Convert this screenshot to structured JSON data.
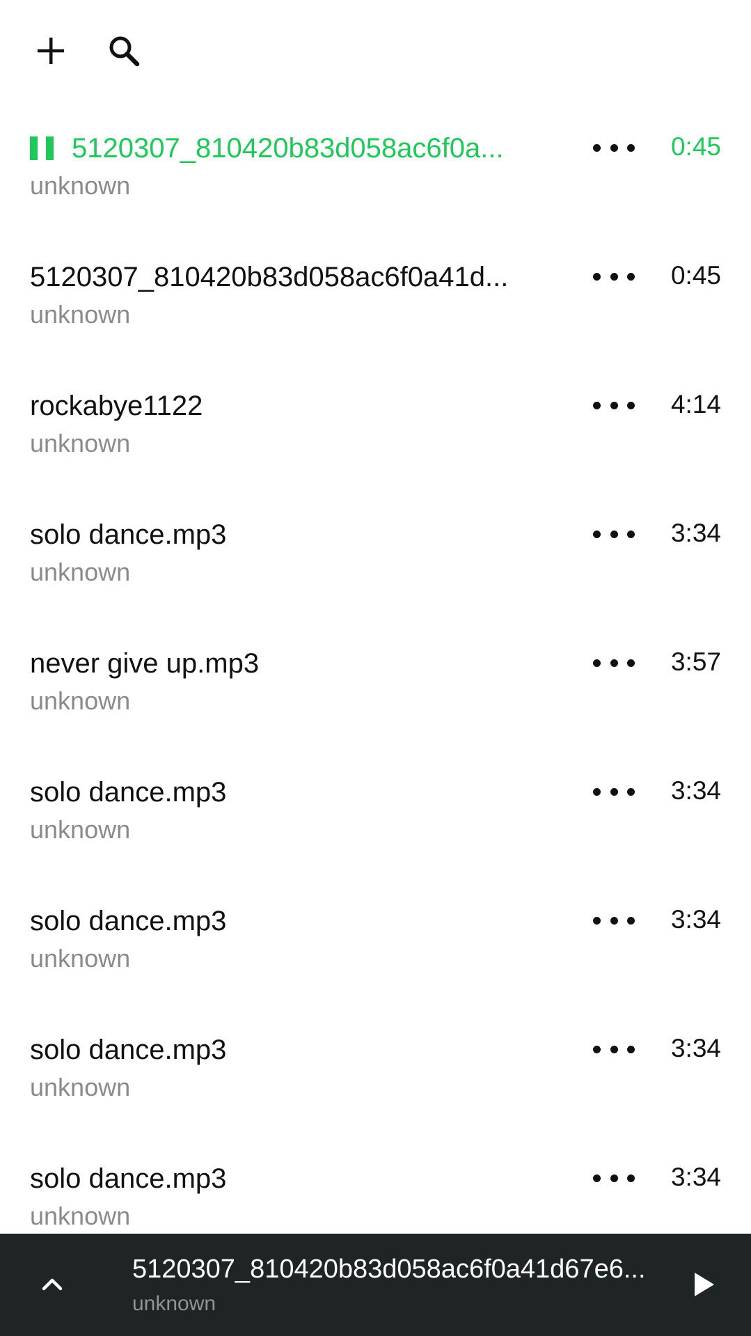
{
  "toolbar": {
    "add_icon": "plus-icon",
    "search_icon": "search-icon"
  },
  "colors": {
    "accent": "#1ec95a",
    "player_bg": "#1f2424",
    "secondary_text": "#8a8a8a"
  },
  "tracks": [
    {
      "title": "5120307_810420b83d058ac6f0a...",
      "artist": "unknown",
      "duration": "0:45",
      "playing": true
    },
    {
      "title": "5120307_810420b83d058ac6f0a41d...",
      "artist": "unknown",
      "duration": "0:45",
      "playing": false
    },
    {
      "title": "rockabye1122",
      "artist": "unknown",
      "duration": "4:14",
      "playing": false
    },
    {
      "title": "solo dance.mp3",
      "artist": "unknown",
      "duration": "3:34",
      "playing": false
    },
    {
      "title": "never give up.mp3",
      "artist": "unknown",
      "duration": "3:57",
      "playing": false
    },
    {
      "title": "solo dance.mp3",
      "artist": "unknown",
      "duration": "3:34",
      "playing": false
    },
    {
      "title": "solo dance.mp3",
      "artist": "unknown",
      "duration": "3:34",
      "playing": false
    },
    {
      "title": "solo dance.mp3",
      "artist": "unknown",
      "duration": "3:34",
      "playing": false
    },
    {
      "title": "solo dance.mp3",
      "artist": "unknown",
      "duration": "3:34",
      "playing": false
    }
  ],
  "mini_player": {
    "title": "5120307_810420b83d058ac6f0a41d67e6...",
    "artist": "unknown",
    "expand_icon": "chevron-up-icon",
    "play_icon": "play-icon"
  }
}
